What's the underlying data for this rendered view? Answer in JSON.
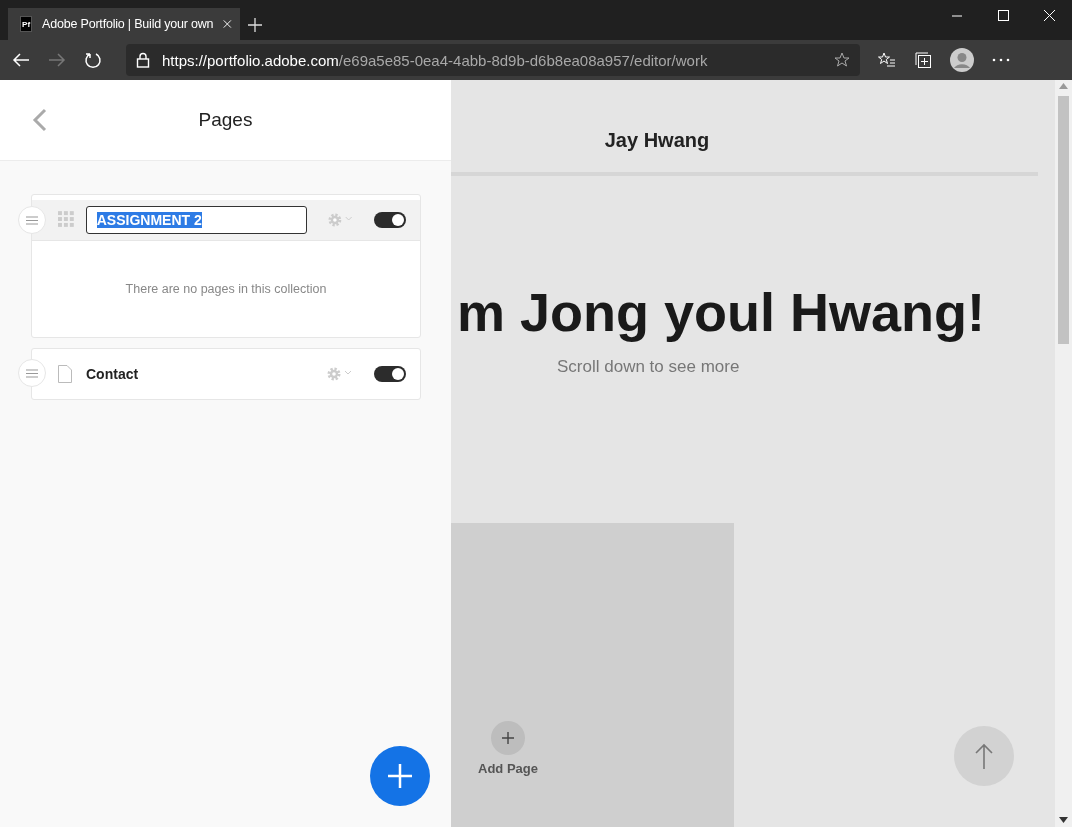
{
  "browser": {
    "tab": {
      "favicon": "Pf",
      "title": "Adobe Portfolio | Build your own",
      "selected": true
    },
    "url_host": "https://portfolio.adobe.com",
    "url_path": "/e69a5e85-0ea4-4abb-8d9b-d6b8ea08a957/editor/work"
  },
  "panel": {
    "title": "Pages",
    "items": [
      {
        "kind": "collection",
        "name": "ASSIGNMENT 2",
        "editing": true,
        "visible": true,
        "empty_text": "There are no pages in this collection"
      },
      {
        "kind": "page",
        "name": "Contact",
        "editing": false,
        "visible": true
      }
    ]
  },
  "preview": {
    "site_title": "Jay Hwang",
    "headline": "m Jong youl Hwang!",
    "subtitle": "Scroll down to see more",
    "add_page": "Add Page"
  }
}
